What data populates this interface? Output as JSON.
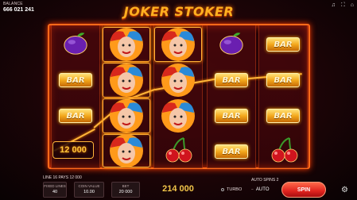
{
  "header": {
    "balance_label": "BALANCE",
    "balance_value": "666 021 241",
    "logo_text": "JOKER STOKER",
    "icons": [
      "sound-icon",
      "fullscreen-icon",
      "home-icon"
    ]
  },
  "reels": [
    [
      "plum",
      "bar",
      "bar",
      "win-12000"
    ],
    [
      "joker",
      "joker",
      "joker",
      "joker"
    ],
    [
      "joker",
      "joker",
      "joker",
      "cherry"
    ],
    [
      "plum",
      "bar",
      "bar",
      "bar"
    ],
    [
      "bar",
      "bar",
      "bar",
      "cherry"
    ]
  ],
  "symbols": {
    "bar_label": "BAR"
  },
  "win_badge": "12 000",
  "footer": {
    "line_info": "LINE 16 PAYS 12 000",
    "fixed_lines_label": "FIXED LINES",
    "fixed_lines_value": "40",
    "coin_value_label": "COIN VALUE",
    "coin_value_value": "10.00",
    "bet_label": "BET",
    "bet_value": "20 000",
    "win_total": "214 000",
    "turbo_label": "TURBO",
    "auto_spins_label": "AUTO SPINS 2",
    "auto_label": "AUTO",
    "spin_label": "SPIN"
  },
  "colors": {
    "accent_orange": "#ff6a1a",
    "gold": "#f2c64a",
    "spin_red": "#e0231e"
  }
}
